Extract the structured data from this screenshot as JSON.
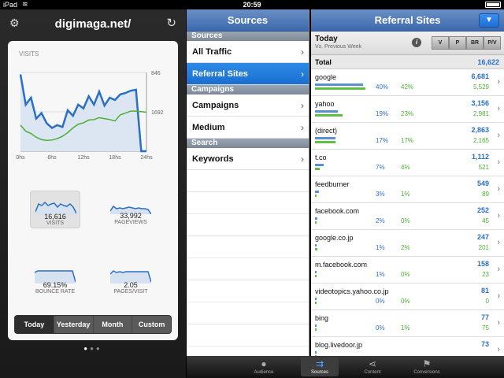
{
  "status": {
    "device": "iPad",
    "time": "20:59"
  },
  "left": {
    "title": "digimaga.net/",
    "visits_label": "VISITS",
    "y_ticks": [
      "1692",
      "846"
    ],
    "x_ticks": [
      "0hs",
      "6hs",
      "12hs",
      "18hs",
      "24hs"
    ],
    "metrics": [
      {
        "value": "16,616",
        "label": "VISITS",
        "selected": true
      },
      {
        "value": "33,992",
        "label": "PAGEVIEWS",
        "selected": false
      },
      {
        "value": "69.15%",
        "label": "BOUNCE RATE",
        "selected": false
      },
      {
        "value": "2.05",
        "label": "PAGES/VISIT",
        "selected": false
      }
    ],
    "periods": [
      "Today",
      "Yesterday",
      "Month",
      "Custom"
    ],
    "active_period": "Today"
  },
  "chart_data": {
    "type": "line",
    "title": "",
    "xlabel": "",
    "ylabel": "",
    "x": [
      0,
      1,
      2,
      3,
      4,
      5,
      6,
      7,
      8,
      9,
      10,
      11,
      12,
      13,
      14,
      15,
      16,
      17,
      18,
      19,
      20,
      21,
      22,
      23,
      24
    ],
    "ylim": [
      0,
      1692
    ],
    "x_ticks": [
      "0hs",
      "6hs",
      "12hs",
      "18hs",
      "24hs"
    ],
    "y_ticks": [
      846,
      1692
    ],
    "series": [
      {
        "color": "#2a6fc6",
        "values": [
          1650,
          1000,
          1150,
          700,
          820,
          600,
          500,
          560,
          520,
          880,
          760,
          1000,
          920,
          1180,
          1000,
          1280,
          980,
          1150,
          1100,
          1220,
          1250,
          1300,
          1320,
          0,
          0
        ]
      },
      {
        "color": "#4ab030",
        "values": [
          560,
          430,
          380,
          300,
          250,
          230,
          240,
          270,
          320,
          400,
          500,
          580,
          610,
          670,
          680,
          720,
          700,
          680,
          650,
          780,
          820,
          860,
          860,
          850,
          840
        ]
      }
    ]
  },
  "sources": {
    "title": "Sources",
    "sections": [
      {
        "header": "Sources",
        "items": [
          "All Traffic",
          "Referral Sites"
        ]
      },
      {
        "header": "Campaigns",
        "items": [
          "Campaigns",
          "Medium"
        ]
      },
      {
        "header": "Search",
        "items": [
          "Keywords"
        ]
      }
    ],
    "selected": "Referral Sites"
  },
  "referral": {
    "title": "Referral Sites",
    "period": "Today",
    "compare": "Vs. Previous Week",
    "buttons": [
      "V",
      "P",
      "BR",
      "P/V"
    ],
    "total_label": "Total",
    "total_value": "16,622",
    "rows": [
      {
        "name": "google",
        "pct1": "40%",
        "pct2": "42%",
        "v1": "6,681",
        "v2": "5,529",
        "f1": 0.4,
        "f2": 0.42
      },
      {
        "name": "yahoo",
        "pct1": "19%",
        "pct2": "23%",
        "v1": "3,156",
        "v2": "2,981",
        "f1": 0.19,
        "f2": 0.23
      },
      {
        "name": "(direct)",
        "pct1": "17%",
        "pct2": "17%",
        "v1": "2,863",
        "v2": "2,165",
        "f1": 0.17,
        "f2": 0.17
      },
      {
        "name": "t.co",
        "pct1": "7%",
        "pct2": "4%",
        "v1": "1,112",
        "v2": "521",
        "f1": 0.07,
        "f2": 0.04
      },
      {
        "name": "feedburner",
        "pct1": "3%",
        "pct2": "1%",
        "v1": "549",
        "v2": "89",
        "f1": 0.03,
        "f2": 0.01
      },
      {
        "name": "facebook.com",
        "pct1": "2%",
        "pct2": "0%",
        "v1": "252",
        "v2": "45",
        "f1": 0.02,
        "f2": 0.0
      },
      {
        "name": "google.co.jp",
        "pct1": "1%",
        "pct2": "2%",
        "v1": "247",
        "v2": "201",
        "f1": 0.01,
        "f2": 0.02
      },
      {
        "name": "m.facebook.com",
        "pct1": "1%",
        "pct2": "0%",
        "v1": "158",
        "v2": "23",
        "f1": 0.01,
        "f2": 0.0
      },
      {
        "name": "videotopics.yahoo.co.jp",
        "pct1": "0%",
        "pct2": "0%",
        "v1": "81",
        "v2": "0",
        "f1": 0.0,
        "f2": 0.0
      },
      {
        "name": "bing",
        "pct1": "0%",
        "pct2": "1%",
        "v1": "77",
        "v2": "75",
        "f1": 0.0,
        "f2": 0.01
      },
      {
        "name": "blog.livedoor.jp",
        "pct1": "",
        "pct2": "",
        "v1": "73",
        "v2": "",
        "f1": 0.0,
        "f2": 0.0
      }
    ]
  },
  "tabs": [
    {
      "label": "Audience",
      "icon": "person-icon"
    },
    {
      "label": "Sources",
      "icon": "arrow-icon",
      "active": true
    },
    {
      "label": "Content",
      "icon": "share-icon"
    },
    {
      "label": "Conversions",
      "icon": "flag-icon"
    }
  ]
}
